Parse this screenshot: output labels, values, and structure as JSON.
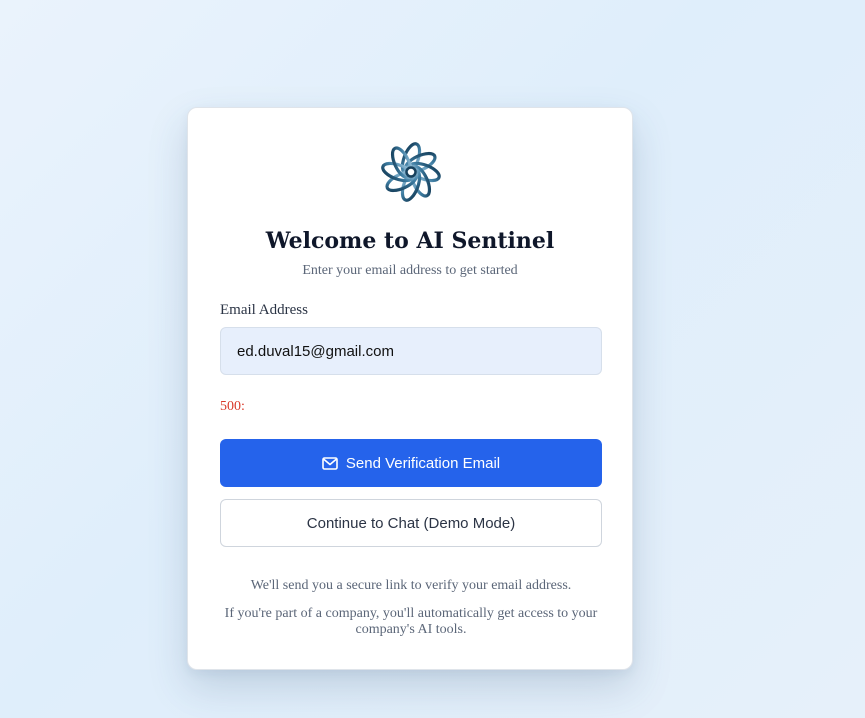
{
  "card": {
    "title": "Welcome to AI Sentinel",
    "subtitle": "Enter your email address to get started"
  },
  "form": {
    "email_label": "Email Address",
    "email_value": "ed.duval15@gmail.com",
    "error_text": "500:",
    "send_button_label": "Send Verification Email",
    "send_button_icon": "mail-icon",
    "demo_button_label": "Continue to Chat (Demo Mode)"
  },
  "footer": {
    "note_1": "We'll send you a secure link to verify your email address.",
    "note_2": "If you're part of a company, you'll automatically get access to your company's AI tools."
  },
  "colors": {
    "primary": "#2563eb",
    "error": "#d93a2b",
    "input_bg": "#e7effc",
    "logo": "#1e4a66"
  },
  "logo_icon": "sentinel-flower-logo-icon"
}
